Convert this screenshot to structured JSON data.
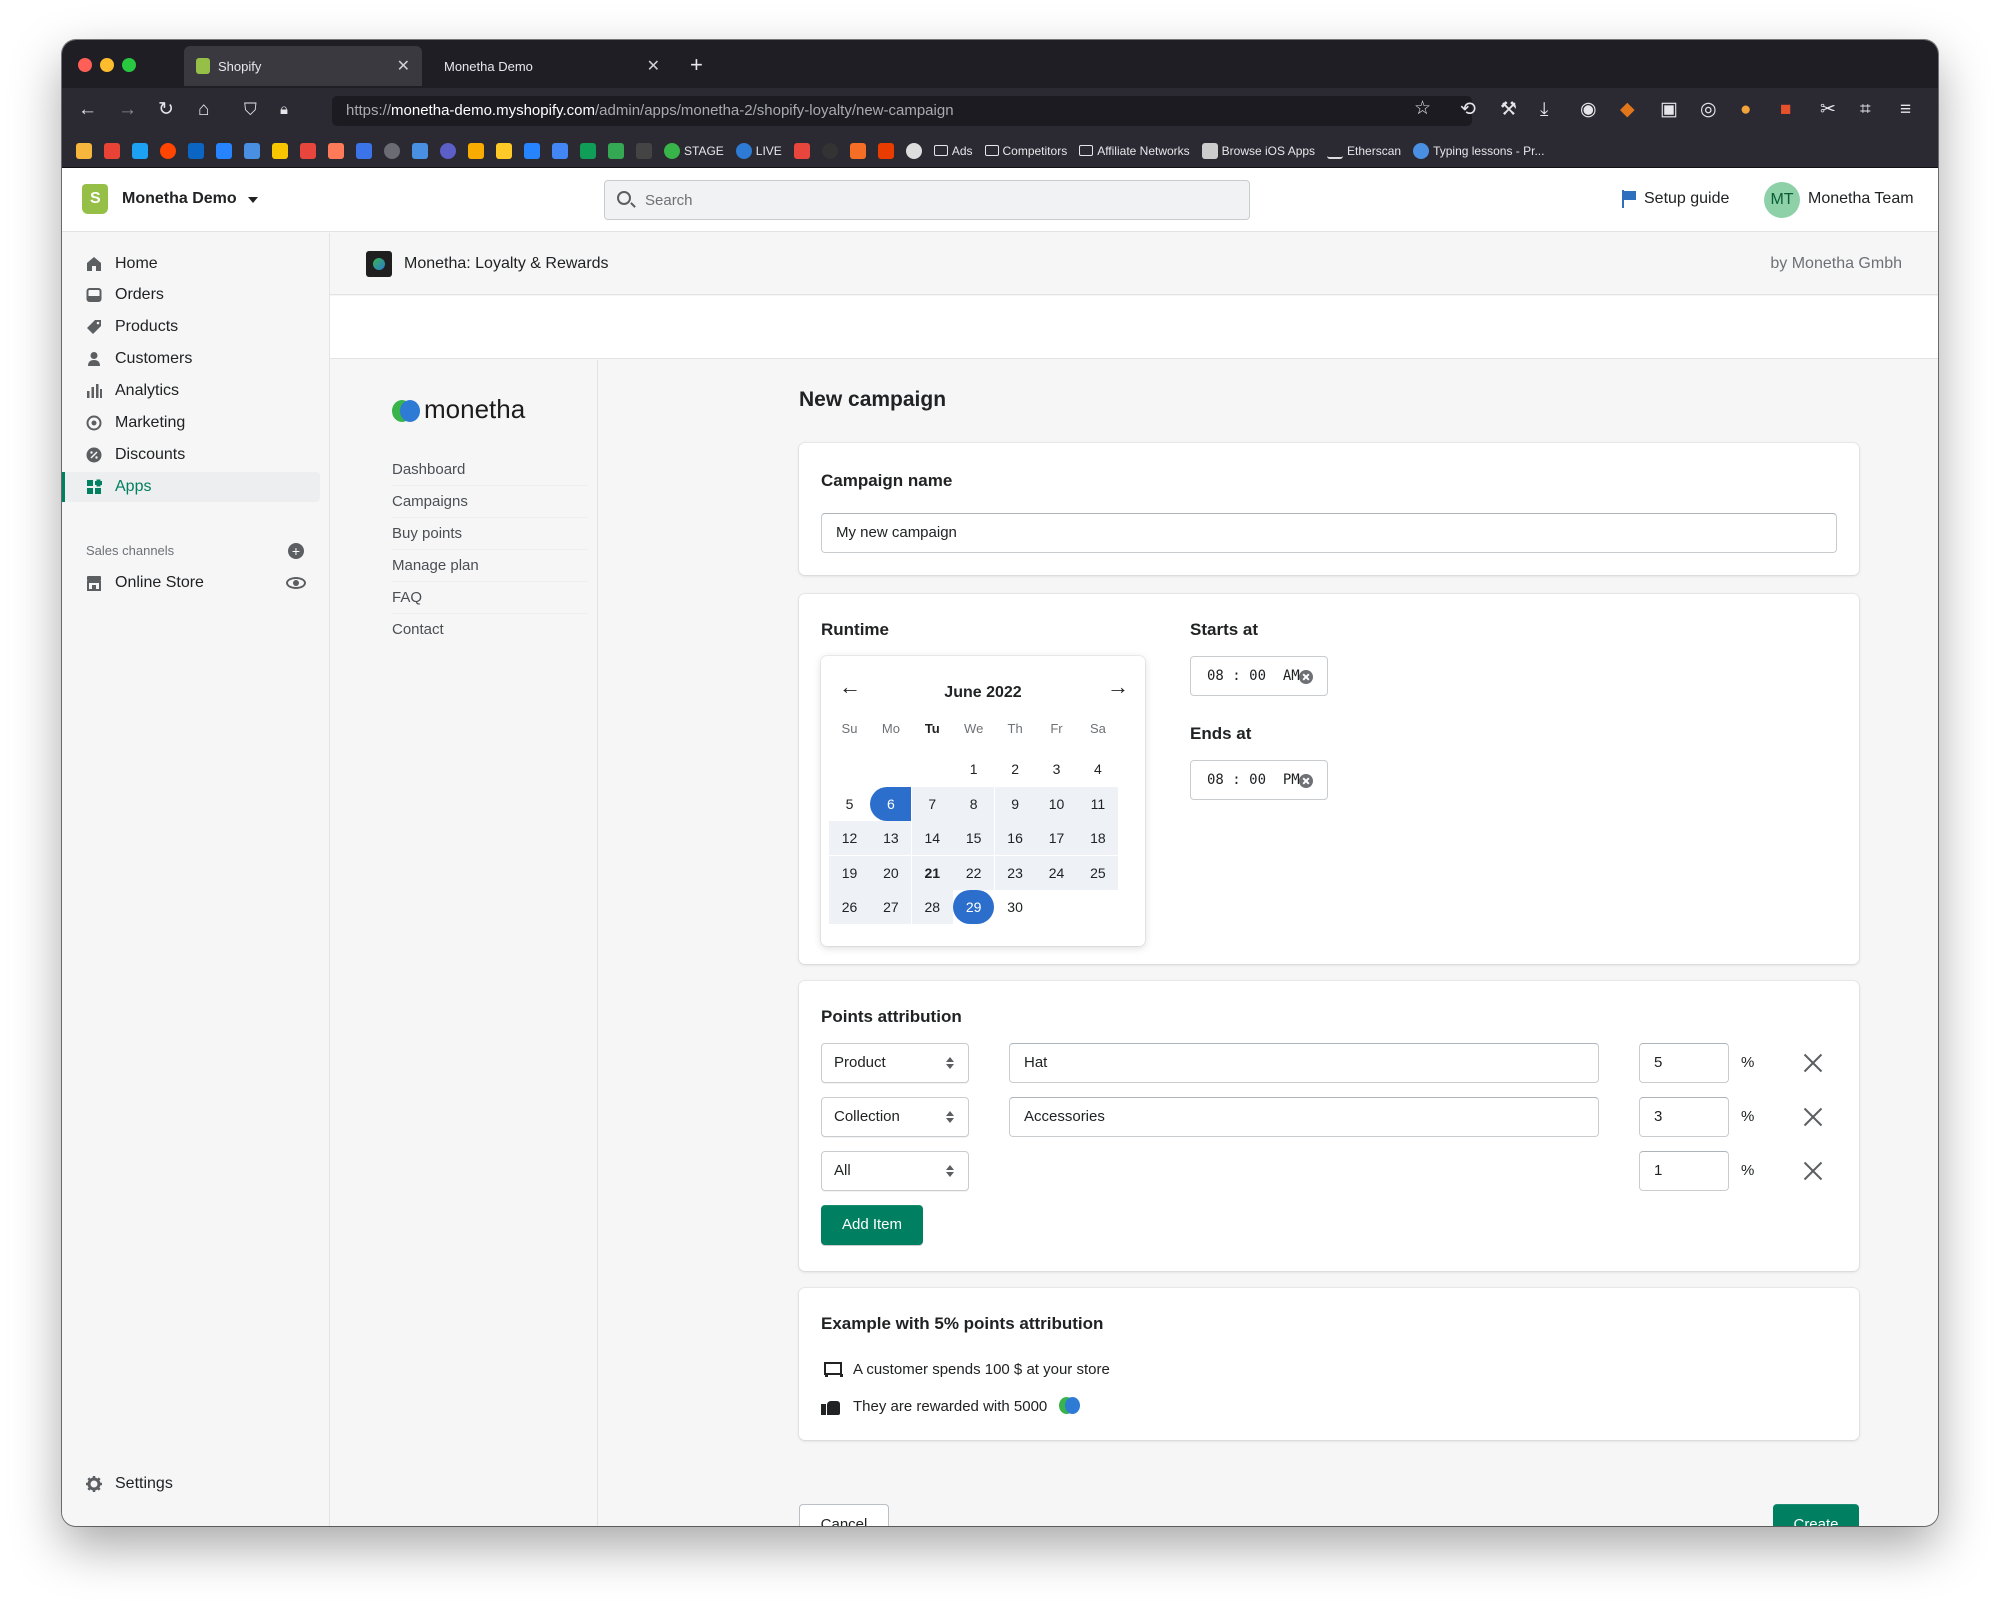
{
  "browser": {
    "tabs": [
      {
        "title": "Shopify",
        "active": true
      },
      {
        "title": "Monetha Demo",
        "active": false
      }
    ],
    "url_prefix": "https://",
    "url_host": "monetha-demo.myshopify.com",
    "url_path": "/admin/apps/monetha-2/shopify-loyalty/new-campaign",
    "bookmarks": [
      "STAGE",
      "LIVE",
      "Ads",
      "Competitors",
      "Affiliate Networks",
      "Browse iOS Apps",
      "Etherscan",
      "Typing lessons - Pr..."
    ]
  },
  "topbar": {
    "store_name": "Monetha Demo",
    "search_placeholder": "Search",
    "setup_guide": "Setup guide",
    "avatar_initials": "MT",
    "team_name": "Monetha Team"
  },
  "sidebar": {
    "items": [
      "Home",
      "Orders",
      "Products",
      "Customers",
      "Analytics",
      "Marketing",
      "Discounts",
      "Apps"
    ],
    "active": "Apps",
    "sales_channels_label": "Sales channels",
    "online_store": "Online Store",
    "settings": "Settings"
  },
  "app_header": {
    "title": "Monetha: Loyalty & Rewards",
    "by": "by Monetha Gmbh"
  },
  "monetha_nav": {
    "logo_text": "monetha",
    "items": [
      "Dashboard",
      "Campaigns",
      "Buy points",
      "Manage plan",
      "FAQ",
      "Contact"
    ]
  },
  "main": {
    "page_title": "New campaign",
    "campaign_name": {
      "label": "Campaign name",
      "value": "My new campaign"
    },
    "runtime": {
      "label": "Runtime",
      "month": "June 2022",
      "weekdays": [
        "Su",
        "Mo",
        "Tu",
        "We",
        "Th",
        "Fr",
        "Sa"
      ],
      "today_weekday": "Tu",
      "days_in_month": 30,
      "first_weekday_index": 3,
      "range_start": 6,
      "range_end": 29,
      "today": 21,
      "starts_at_label": "Starts at",
      "starts_at_value": "08 : 00  AM",
      "ends_at_label": "Ends at",
      "ends_at_value": "08 : 00  PM"
    },
    "points": {
      "label": "Points attribution",
      "rows": [
        {
          "type": "Product",
          "target": "Hat",
          "percent": "5",
          "unit": "%"
        },
        {
          "type": "Collection",
          "target": "Accessories",
          "percent": "3",
          "unit": "%"
        },
        {
          "type": "All",
          "target": null,
          "percent": "1",
          "unit": "%"
        }
      ],
      "add_item": "Add Item"
    },
    "example": {
      "title": "Example with 5% points attribution",
      "line1": "A customer spends 100 $ at your store",
      "line2": "They are rewarded with 5000"
    },
    "cancel": "Cancel",
    "create": "Create"
  },
  "colors": {
    "primary_green": "#008060",
    "selected_blue": "#2c6ecb",
    "shopify_green": "#95bf47",
    "monetha_green": "#38b44a",
    "monetha_blue": "#2d7bd4"
  }
}
